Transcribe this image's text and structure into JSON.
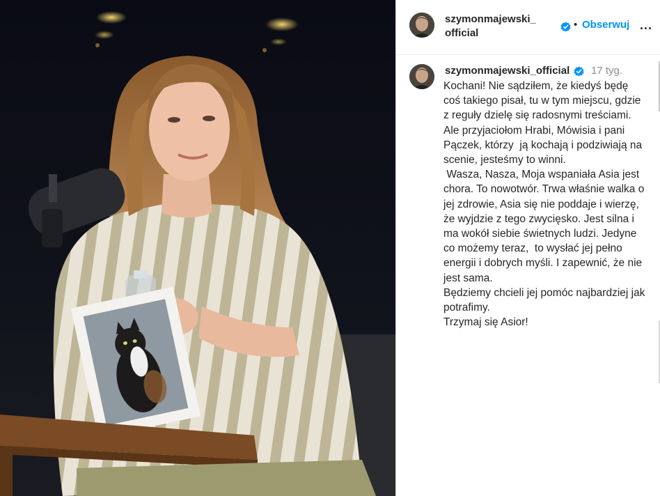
{
  "post": {
    "header": {
      "username": "szymonmajewski_official",
      "dot": "•",
      "follow_label": "Obserwuj",
      "more_label": "..."
    },
    "caption": {
      "username": "szymonmajewski_official",
      "time": "17 tyg.",
      "text": "Kochani! Nie sądziłem, że kiedyś będę coś takiego pisał, tu w tym miejscu, gdzie z reguły dzielę się radosnymi treściami. Ale przyjaciołom Hrabi, Mówisia i pani Pączek, którzy  ją kochają i podziwiają na scenie, jesteśmy to winni.\n Wasza, Nasza, Moja wspaniała Asia jest chora. To nowotwór. Trwa właśnie walka o jej zdrowie, Asia się nie poddaje i wierzę,  że wyjdzie z tego zwycięsko. Jest silna i ma wokół siebie świetnych ludzi. Jedyne co możemy teraz,  to wysłać jej pełno energii i dobrych myśli. I zapewnić, że nie jest sama.\nBędziemy chcieli jej pomóc najbardziej jak potrafimy.\nTrzymaj się Asior!"
    },
    "icons": {
      "verified": "verified-badge-icon",
      "more": "more-options-icon"
    },
    "colors": {
      "link_blue": "#0095f6",
      "verified_blue": "#0095f6",
      "text": "#262626",
      "muted": "#8e8e8e"
    }
  }
}
